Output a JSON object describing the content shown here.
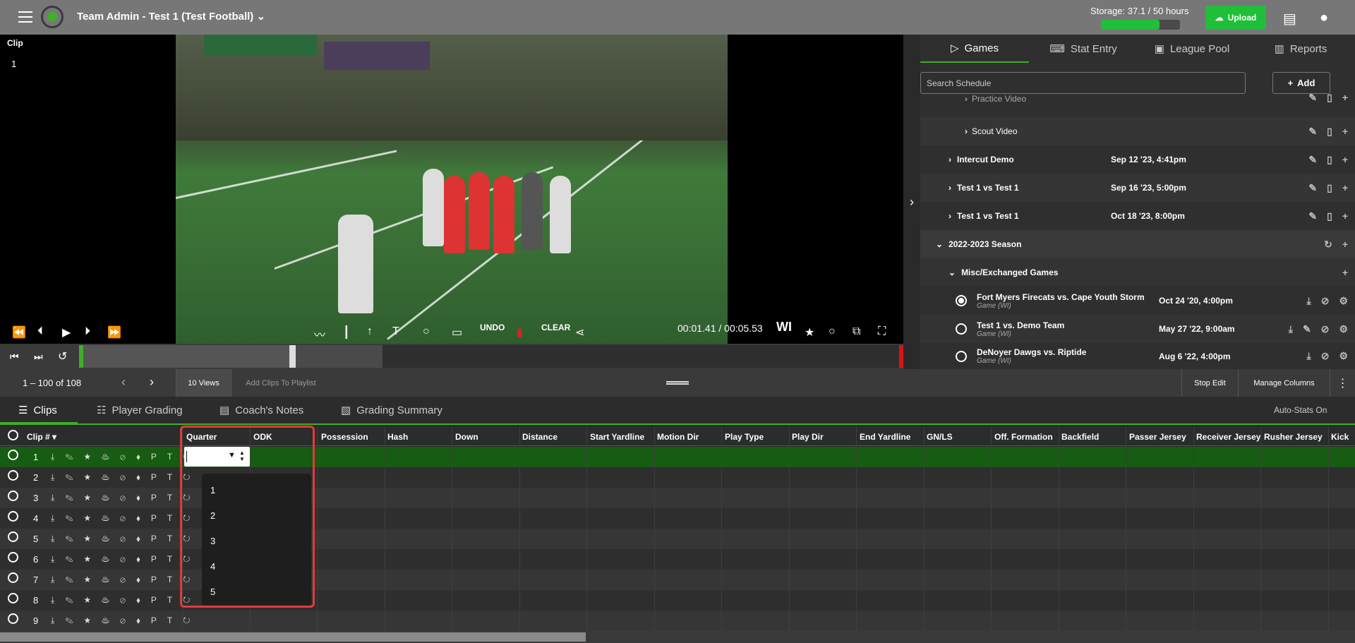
{
  "topbar": {
    "team_title": "Team Admin - Test 1 (Test Football)",
    "storage_label": "Storage: 37.1 / 50 hours",
    "storage_fraction": 0.742,
    "upload_label": "Upload"
  },
  "player": {
    "clip_label": "Clip",
    "clip_number": "1",
    "undo_label": "UNDO",
    "clear_label": "CLEAR",
    "timecode": "00:01.41 / 00:05.53",
    "wi_label": "WI"
  },
  "sidepanel": {
    "tabs": [
      {
        "label": "Games",
        "icon": "play-circle-icon"
      },
      {
        "label": "Stat Entry",
        "icon": "keyboard-icon"
      },
      {
        "label": "League Pool",
        "icon": "video-library-icon"
      },
      {
        "label": "Reports",
        "icon": "bar-chart-icon"
      }
    ],
    "search_placeholder": "Search Schedule",
    "add_label": "Add",
    "rows": [
      {
        "label": "Practice Video",
        "date": ""
      },
      {
        "label": "Scout Video",
        "date": ""
      },
      {
        "label": "Intercut Demo",
        "date": "Sep 12 '23, 4:41pm"
      },
      {
        "label": "Test 1 vs Test 1",
        "date": "Sep 16 '23, 5:00pm"
      },
      {
        "label": "Test 1 vs Test 1",
        "date": "Oct 18 '23, 8:00pm"
      },
      {
        "label": "2022-2023 Season",
        "date": ""
      },
      {
        "label": "Misc/Exchanged Games",
        "date": ""
      },
      {
        "label": "Fort Myers Firecats vs. Cape Youth Storm",
        "sub": "Game (WI)",
        "date": "Oct 24 '20, 4:00pm"
      },
      {
        "label": "Test 1 vs. Demo Team",
        "sub": "Game (WI)",
        "date": "May 27 '22, 9:00am"
      },
      {
        "label": "DeNoyer Dawgs vs. Riptide",
        "sub": "Game (WI)",
        "date": "Aug 6 '22, 4:00pm"
      }
    ]
  },
  "toolbar2": {
    "pager": "1 – 100 of 108",
    "views_label": "10 Views",
    "add_clips_label": "Add Clips To Playlist",
    "stop_edit_label": "Stop Edit",
    "manage_columns_label": "Manage Columns"
  },
  "tabs2": {
    "clips": "Clips",
    "player_grading": "Player Grading",
    "coachs_notes": "Coach's Notes",
    "grading_summary": "Grading Summary",
    "auto_stats": "Auto-Stats On"
  },
  "grid": {
    "columns": [
      "Clip #",
      "Quarter",
      "ODK",
      "Possession",
      "Hash",
      "Down",
      "Distance",
      "Start Yardline",
      "Motion Dir",
      "Play Type",
      "Play Dir",
      "End Yardline",
      "GN/LS",
      "Off. Formation",
      "Backfield",
      "Passer Jersey",
      "Receiver Jersey",
      "Rusher Jersey",
      "Kick"
    ],
    "rows": [
      "1",
      "2",
      "3",
      "4",
      "5",
      "6",
      "7",
      "8",
      "9"
    ],
    "row_icons": "⤓ ✎ ★ ♨ ⊘ ⬧ P T ↻"
  },
  "quarter_dropdown": {
    "options": [
      "1",
      "2",
      "3",
      "4",
      "5"
    ]
  }
}
